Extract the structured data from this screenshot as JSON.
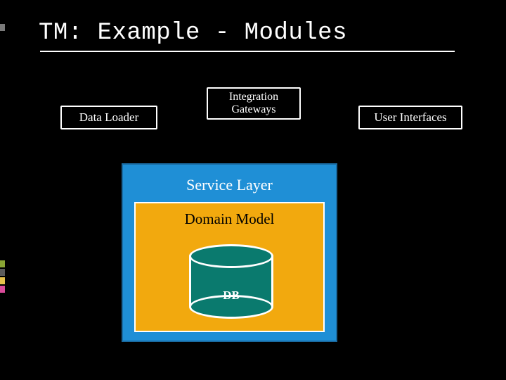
{
  "slide": {
    "title": "TM: Example - Modules"
  },
  "modules": {
    "data_loader": "Data Loader",
    "integration_gateways": "Integration\nGateways",
    "user_interfaces": "User Interfaces"
  },
  "layers": {
    "service_layer": "Service Layer",
    "domain_model": "Domain Model",
    "db": "DB"
  },
  "colors": {
    "service_layer_bg": "#1f8fd6",
    "domain_model_bg": "#f2a90e",
    "db_fill": "#0a7a6e"
  }
}
